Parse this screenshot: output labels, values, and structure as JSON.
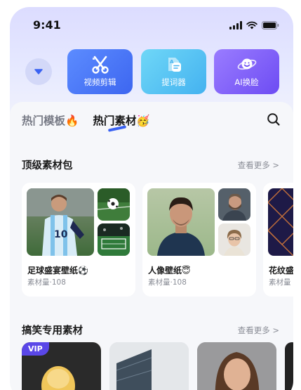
{
  "status_bar": {
    "time": "9:41"
  },
  "quick_actions": [
    {
      "label": "视频剪辑",
      "icon": "scissors-icon"
    },
    {
      "label": "提词器",
      "icon": "teleprompter-icon"
    },
    {
      "label": "AI换脸",
      "icon": "ai-face-swap-icon"
    }
  ],
  "tabs": [
    {
      "label": "热门模板🔥",
      "active": false
    },
    {
      "label": "热门素材🥳",
      "active": true
    }
  ],
  "sections": {
    "top_packs": {
      "title": "顶级素材包",
      "more": "查看更多 >",
      "packs": [
        {
          "title": "足球盛宴壁纸⚽",
          "count": "素材量·108"
        },
        {
          "title": "人像壁纸😇",
          "count": "素材量·108"
        },
        {
          "title": "花纹盛",
          "count": "素材量"
        }
      ]
    },
    "funny": {
      "title": "搞笑专用素材",
      "more": "查看更多 >",
      "vip_badge": "VIP"
    }
  },
  "colors": {
    "accent": "#3a62f2",
    "video_button": "#4a75f7",
    "lyric_button": "#55c3f3",
    "ai_button": "#7e5df7",
    "vip": "#5a47e8"
  }
}
